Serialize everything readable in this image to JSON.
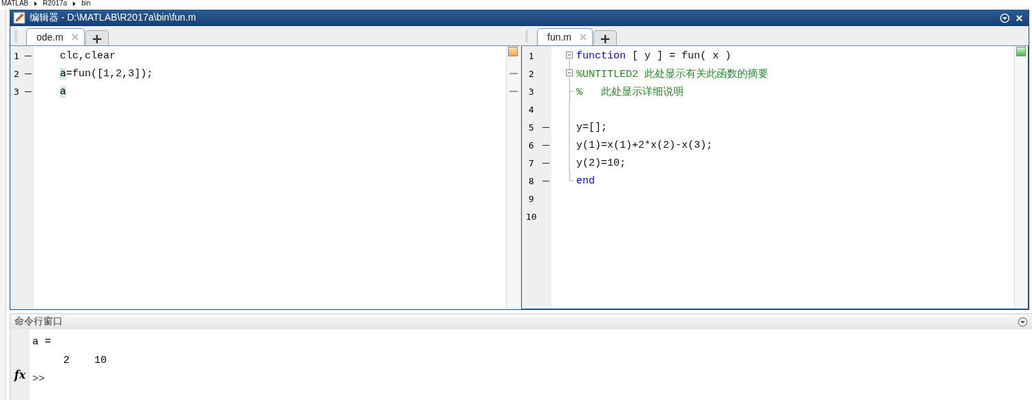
{
  "breadcrumb": [
    "MATLAB",
    "R2017a",
    "bin"
  ],
  "window": {
    "title": "编辑器 - D:\\MATLAB\\R2017a\\bin\\fun.m"
  },
  "panes": [
    {
      "warning": true,
      "tabs": [
        {
          "label": "ode.m",
          "selected": true
        }
      ],
      "add": "+",
      "lines": [
        {
          "number": "1",
          "executable": true,
          "mark": false,
          "segments": [
            {
              "kind": "plain",
              "text": "clc,clear"
            }
          ]
        },
        {
          "number": "2",
          "executable": true,
          "mark": true,
          "segments": [
            {
              "kind": "highlight",
              "text": "a"
            },
            {
              "kind": "plain",
              "text": "=fun([1,2,3]);"
            }
          ]
        },
        {
          "number": "3",
          "executable": true,
          "mark": true,
          "segments": [
            {
              "kind": "highlight",
              "text": "a"
            }
          ]
        }
      ]
    },
    {
      "warning": false,
      "tabs": [
        {
          "label": "fun.m",
          "selected": true
        }
      ],
      "add": "+",
      "lines": [
        {
          "number": "1",
          "kind": "open",
          "executable": false,
          "segments": [
            {
              "kind": "keyword",
              "text": "function"
            },
            {
              "kind": "plain",
              "text": " [ y ] = fun( x )"
            }
          ]
        },
        {
          "number": "2",
          "kind": "open",
          "executable": false,
          "segments": [
            {
              "kind": "comment",
              "text": "%UNTITLED2 此处显示有关此函数的摘要"
            }
          ]
        },
        {
          "number": "3",
          "kind": "tick",
          "executable": false,
          "segments": [
            {
              "kind": "comment",
              "text": "%   此处显示详细说明"
            }
          ]
        },
        {
          "number": "4",
          "kind": "line",
          "executable": false
        },
        {
          "number": "5",
          "kind": "line",
          "executable": true,
          "segments": [
            {
              "kind": "plain",
              "text": "y=[];"
            }
          ]
        },
        {
          "number": "6",
          "kind": "line",
          "executable": true,
          "segments": [
            {
              "kind": "plain",
              "text": "y(1)=x(1)+2*x(2)-x(3);"
            }
          ]
        },
        {
          "number": "7",
          "kind": "line",
          "executable": true,
          "segments": [
            {
              "kind": "plain",
              "text": "y(2)=10;"
            }
          ]
        },
        {
          "number": "8",
          "kind": "end",
          "executable": true,
          "segments": [
            {
              "kind": "keyword",
              "text": "end"
            }
          ]
        },
        {
          "number": "9",
          "kind": "plain",
          "executable": false
        },
        {
          "number": "10",
          "kind": "plain",
          "executable": false
        }
      ]
    }
  ],
  "command_window": {
    "title": "命令行窗口",
    "output": [
      "a =",
      "     2    10"
    ],
    "fx": "fx",
    "prompt": ">>"
  }
}
